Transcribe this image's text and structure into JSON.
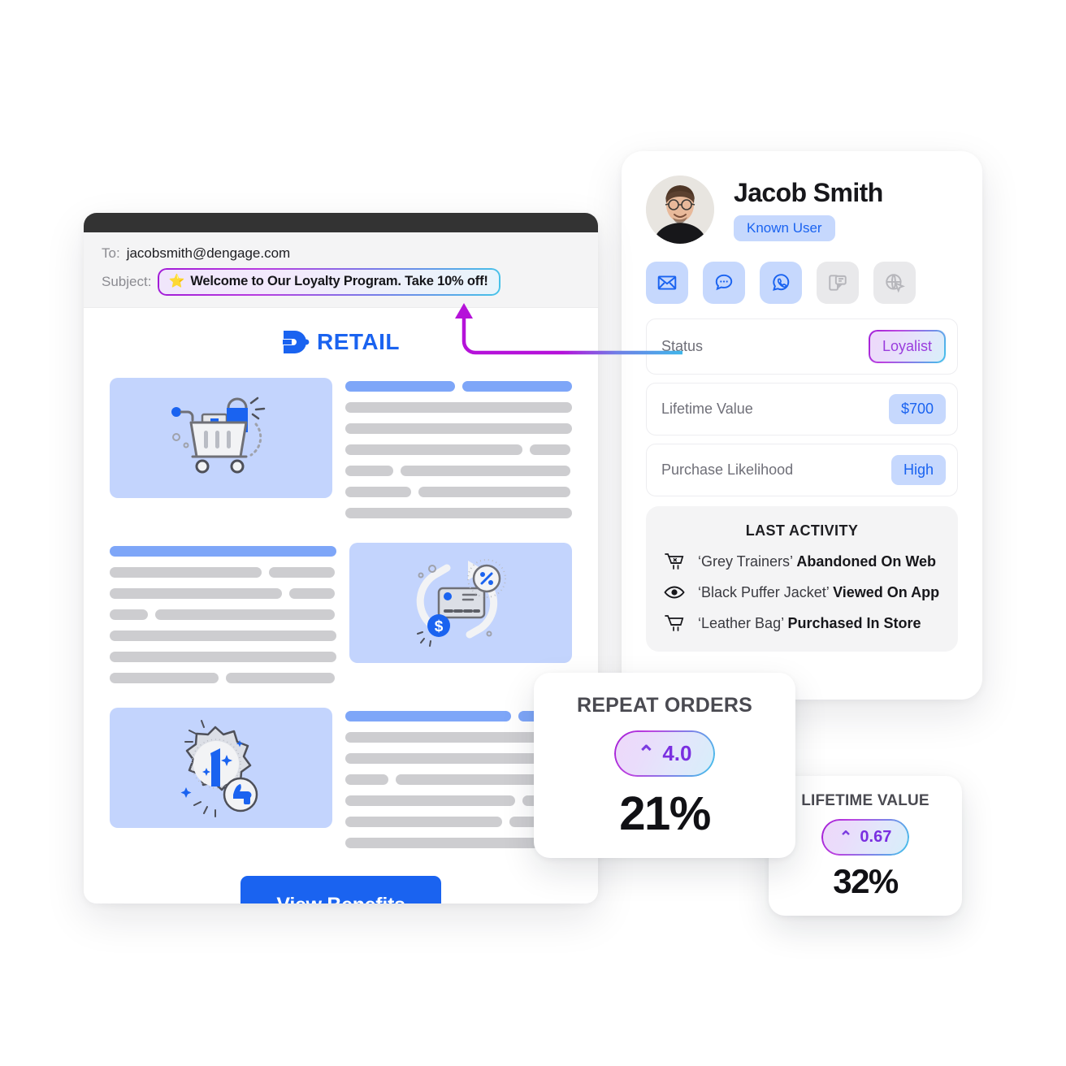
{
  "email": {
    "to_label": "To:",
    "to_value": "jacobsmith@dengage.com",
    "subject_label": "Subject:",
    "subject_star": "⭐",
    "subject_value": "Welcome to Our Loyalty Program. Take 10% off!",
    "brand_name": "RETAIL",
    "cta_label": "View Benefits",
    "illustrations": [
      {
        "name": "shopping-cart-illustration"
      },
      {
        "name": "cashback-card-illustration"
      },
      {
        "name": "loyalty-badge-illustration"
      }
    ]
  },
  "profile": {
    "name": "Jacob Smith",
    "badge": "Known User",
    "avatar_alt": "Jacob Smith profile photo",
    "channels": [
      {
        "name": "email-channel-icon",
        "label": "Email",
        "active": true
      },
      {
        "name": "sms-chat-channel-icon",
        "label": "SMS",
        "active": true
      },
      {
        "name": "whatsapp-channel-icon",
        "label": "WhatsApp",
        "active": true
      },
      {
        "name": "push-notification-channel-icon",
        "label": "Push",
        "active": false
      },
      {
        "name": "web-push-channel-icon",
        "label": "Web Push",
        "active": false
      }
    ],
    "attributes": [
      {
        "key": "Status",
        "value": "Loyalist",
        "style": "gradient"
      },
      {
        "key": "Lifetime Value",
        "value": "$700",
        "style": "blue"
      },
      {
        "key": "Purchase Likelihood",
        "value": "High",
        "style": "blue"
      }
    ],
    "activity": {
      "title": "LAST ACTIVITY",
      "items": [
        {
          "icon": "cart-remove-icon",
          "item": "‘Grey Trainers’",
          "action": "Abandoned On Web"
        },
        {
          "icon": "eye-icon",
          "item": "‘Black Puffer Jacket’",
          "action": "Viewed On App"
        },
        {
          "icon": "cart-icon",
          "item": "‘Leather Bag’",
          "action": "Purchased In Store"
        }
      ]
    }
  },
  "stats": [
    {
      "id": "repeat-orders",
      "title": "REPEAT ORDERS",
      "delta_caret": "⌃",
      "delta": "4.0",
      "value": "21%"
    },
    {
      "id": "lifetime-value",
      "title": "LIFETIME VALUE",
      "delta_caret": "⌃",
      "delta": "0.67",
      "value": "32%"
    }
  ],
  "annotation": {
    "arrow_name": "status-to-subject-arrow",
    "gradient_from": "#3fb6ea",
    "gradient_to": "#b512d9"
  },
  "colors": {
    "brand_blue": "#1a63f0",
    "pill_blue_bg": "#c6d8fd",
    "illustration_bg": "#c3d4fd",
    "page_bg": "#ffffff",
    "card_bg": "#ffffff",
    "muted_bar": "#cdcdd0"
  }
}
